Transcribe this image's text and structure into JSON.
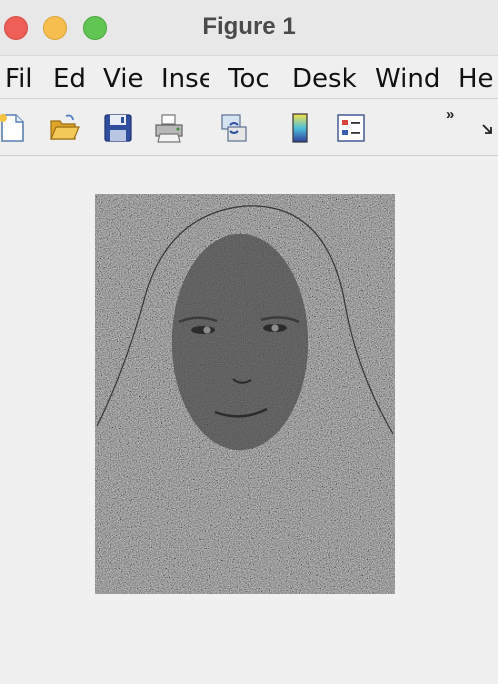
{
  "window": {
    "title": "Figure 1"
  },
  "menu": {
    "items": [
      "Fil",
      "Ed",
      "Vie",
      "Inse",
      "Toc",
      "Desk",
      "Wind",
      "He"
    ]
  },
  "toolbar": {
    "icons": [
      "new-figure-icon",
      "open-folder-icon",
      "save-icon",
      "print-icon",
      "link-plot-icon",
      "colorbar-icon",
      "legend-icon"
    ],
    "overflow_label": "»"
  },
  "colors": {
    "close": "#ee5f57",
    "minimize": "#f6be4f",
    "maximize": "#61c554",
    "canvas_background": "#f0f0f0",
    "image_noise": "#6e6e6e",
    "face_region": "#121212"
  }
}
